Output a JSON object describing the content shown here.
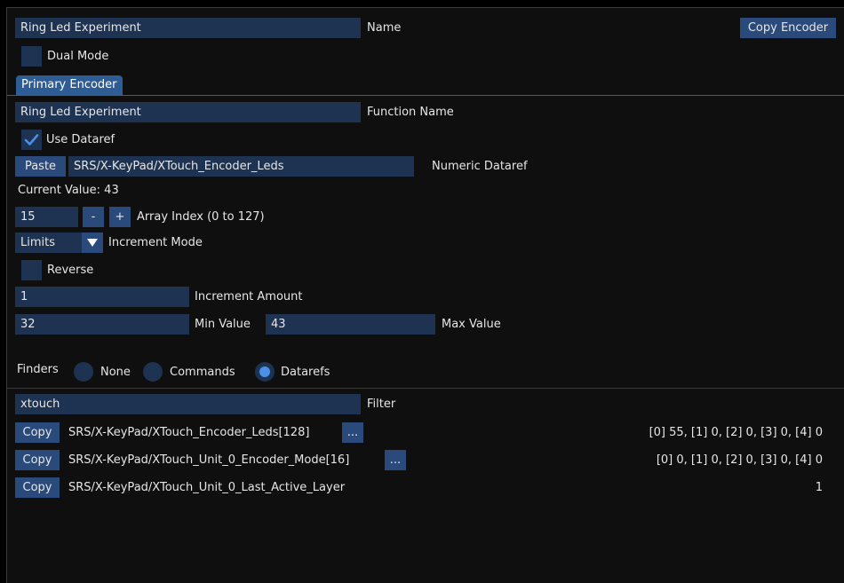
{
  "header": {
    "name_value": "Ring Led Experiment",
    "name_label": "Name",
    "copy_encoder_label": "Copy Encoder",
    "dual_mode_label": "Dual Mode",
    "dual_mode_checked": false
  },
  "tabs": [
    {
      "label": "Primary Encoder",
      "active": true
    }
  ],
  "encoder": {
    "function_name_value": "Ring Led Experiment",
    "function_name_label": "Function Name",
    "use_dataref_label": "Use Dataref",
    "use_dataref_checked": true,
    "paste_label": "Paste",
    "numeric_dataref_value": "SRS/X-KeyPad/XTouch_Encoder_Leds",
    "numeric_dataref_label": "Numeric Dataref",
    "current_value_text": "Current Value: 43",
    "array_index_value": "15",
    "minus_label": "-",
    "plus_label": "+",
    "array_index_label": "Array Index (0 to 127)",
    "increment_mode_value": "Limits",
    "increment_mode_label": "Increment Mode",
    "reverse_label": "Reverse",
    "reverse_checked": false,
    "increment_amount_value": "1",
    "increment_amount_label": "Increment Amount",
    "min_value": "32",
    "min_value_label": "Min Value",
    "max_value": "43",
    "max_value_label": "Max Value"
  },
  "finders": {
    "label": "Finders",
    "options": [
      {
        "label": "None",
        "selected": false
      },
      {
        "label": "Commands",
        "selected": false
      },
      {
        "label": "Datarefs",
        "selected": true
      }
    ],
    "filter_value": "xtouch",
    "filter_label": "Filter",
    "copy_label": "Copy",
    "more_label": "...",
    "results": [
      {
        "name": "SRS/X-KeyPad/XTouch_Encoder_Leds[128]",
        "has_more": true,
        "value": "[0] 55, [1] 0, [2] 0, [3] 0, [4] 0"
      },
      {
        "name": "SRS/X-KeyPad/XTouch_Unit_0_Encoder_Mode[16]",
        "has_more": true,
        "value": "[0] 0, [1] 0, [2] 0, [3] 0, [4] 0"
      },
      {
        "name": "SRS/X-KeyPad/XTouch_Unit_0_Last_Active_Layer",
        "has_more": false,
        "value": "1"
      }
    ]
  },
  "colors": {
    "frame_bg": "#1e3251",
    "button_bg": "#2a4a7c",
    "tab_bg": "#2e5c95",
    "accent": "#4a90e6"
  }
}
